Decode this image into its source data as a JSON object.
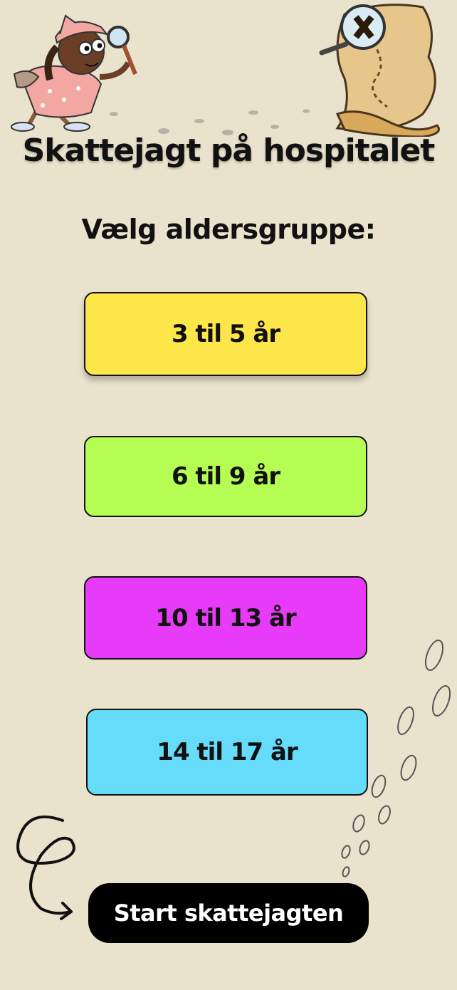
{
  "header": {
    "title": "Skattejagt på hospitalet"
  },
  "age_selection": {
    "prompt": "Vælg aldersgruppe:",
    "options": [
      {
        "label": "3 til 5 år",
        "color": "#fde64a"
      },
      {
        "label": "6 til 9 år",
        "color": "#b5fd53"
      },
      {
        "label": "10 til 13 år",
        "color": "#e83bfa"
      },
      {
        "label": "14 til 17 år",
        "color": "#66dcfb"
      }
    ]
  },
  "actions": {
    "start_label": "Start skattejagten"
  },
  "illustrations": {
    "detective": "detective-girl-illustration",
    "map": "treasure-map-illustration",
    "footprints": "footprints-icon",
    "arrow": "swirl-arrow-icon"
  },
  "colors": {
    "background": "#e9e2cc",
    "start_button": "#000000",
    "text": "#111111"
  }
}
